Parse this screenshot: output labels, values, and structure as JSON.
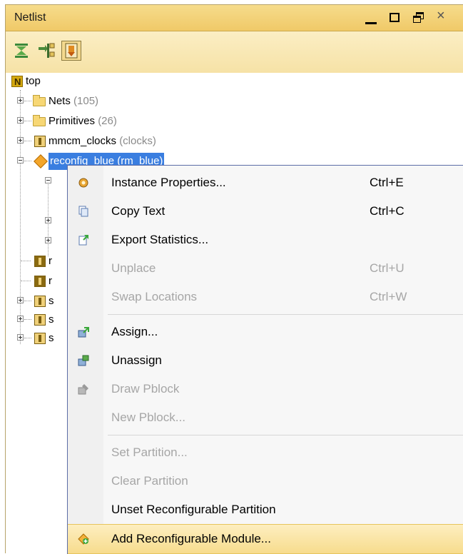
{
  "window": {
    "title": "Netlist"
  },
  "toolbar": {
    "icons": [
      "collapse-all-icon",
      "expand-selected-icon",
      "show-hierarchy-icon"
    ]
  },
  "tree": {
    "root": "top",
    "items": [
      {
        "label": "Nets",
        "count": "(105)",
        "icon": "folder-icon"
      },
      {
        "label": "Primitives",
        "count": "(26)",
        "icon": "folder-icon"
      },
      {
        "label": "mmcm_clocks",
        "count": "(clocks)",
        "icon": "instance-icon"
      },
      {
        "label": "reconfig_blue (rm_blue)",
        "icon": "reconfigurable-partition-icon",
        "selected": true
      },
      {
        "label": "r",
        "icon": "instance-icon"
      },
      {
        "label": "r",
        "icon": "instance-icon"
      },
      {
        "label": "s",
        "icon": "instance-icon"
      },
      {
        "label": "s",
        "icon": "instance-icon"
      },
      {
        "label": "s",
        "icon": "instance-icon"
      }
    ]
  },
  "context_menu": {
    "items": [
      {
        "label": "Instance Properties...",
        "shortcut": "Ctrl+E",
        "enabled": true,
        "icon": "properties-icon"
      },
      {
        "label": "Copy Text",
        "shortcut": "Ctrl+C",
        "enabled": true,
        "icon": "copy-icon"
      },
      {
        "label": "Export Statistics...",
        "shortcut": "",
        "enabled": true,
        "icon": "export-icon"
      },
      {
        "label": "Unplace",
        "shortcut": "Ctrl+U",
        "enabled": false
      },
      {
        "label": "Swap Locations",
        "shortcut": "Ctrl+W",
        "enabled": false
      },
      {
        "label": "Assign...",
        "shortcut": "",
        "enabled": true,
        "icon": "assign-icon"
      },
      {
        "label": "Unassign",
        "shortcut": "",
        "enabled": true,
        "icon": "unassign-icon"
      },
      {
        "label": "Draw Pblock",
        "shortcut": "",
        "enabled": false,
        "icon": "draw-pblock-icon"
      },
      {
        "label": "New Pblock...",
        "shortcut": "",
        "enabled": false
      },
      {
        "label": "Set Partition...",
        "shortcut": "",
        "enabled": false
      },
      {
        "label": "Clear Partition",
        "shortcut": "",
        "enabled": false
      },
      {
        "label": "Unset Reconfigurable Partition",
        "shortcut": "",
        "enabled": true
      },
      {
        "label": "Add Reconfigurable Module...",
        "shortcut": "",
        "enabled": true,
        "highlighted": true,
        "icon": "add-module-icon"
      }
    ]
  },
  "colors": {
    "titlebar": "#f2cf74",
    "toolbar": "#f8e6ae",
    "selection": "#3a7ee0",
    "menu_highlight": "#f9e29b",
    "disabled_text": "#a6a6a6"
  }
}
